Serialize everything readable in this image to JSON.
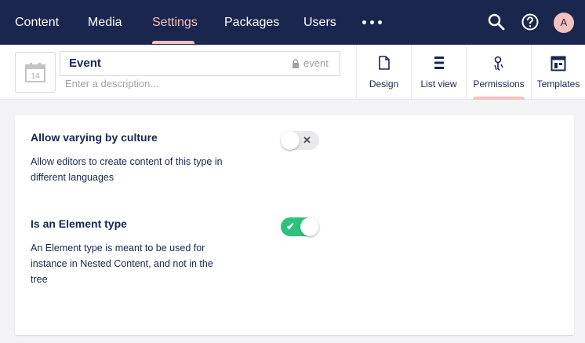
{
  "nav": {
    "items": [
      {
        "label": "Content"
      },
      {
        "label": "Media"
      },
      {
        "label": "Settings"
      },
      {
        "label": "Packages"
      },
      {
        "label": "Users"
      }
    ],
    "active": "Settings",
    "more_icon": "ellipsis-icon",
    "search_icon": "search-icon",
    "help_icon": "help-icon",
    "avatar_initial": "A"
  },
  "header": {
    "icon": "calendar-icon",
    "icon_day": "14",
    "name": "Event",
    "alias": "event",
    "alias_icon": "lock-icon",
    "description_placeholder": "Enter a description...",
    "tabs": [
      {
        "label": "Design",
        "icon": "document-icon"
      },
      {
        "label": "List view",
        "icon": "list-icon"
      },
      {
        "label": "Permissions",
        "icon": "keys-icon"
      },
      {
        "label": "Templates",
        "icon": "template-icon"
      }
    ],
    "active_tab": "Permissions"
  },
  "settings": [
    {
      "title": "Allow varying by culture",
      "description": "Allow editors to create content of this type in different languages",
      "enabled": false
    },
    {
      "title": "Is an Element type",
      "description": "An Element type is meant to be used for instance in Nested Content, and not in the tree",
      "enabled": true
    }
  ],
  "colors": {
    "nav_bg": "#1b264f",
    "accent": "#f5c1bc",
    "toggle_on": "#2bc37c",
    "toggle_off": "#e9e9eb"
  }
}
